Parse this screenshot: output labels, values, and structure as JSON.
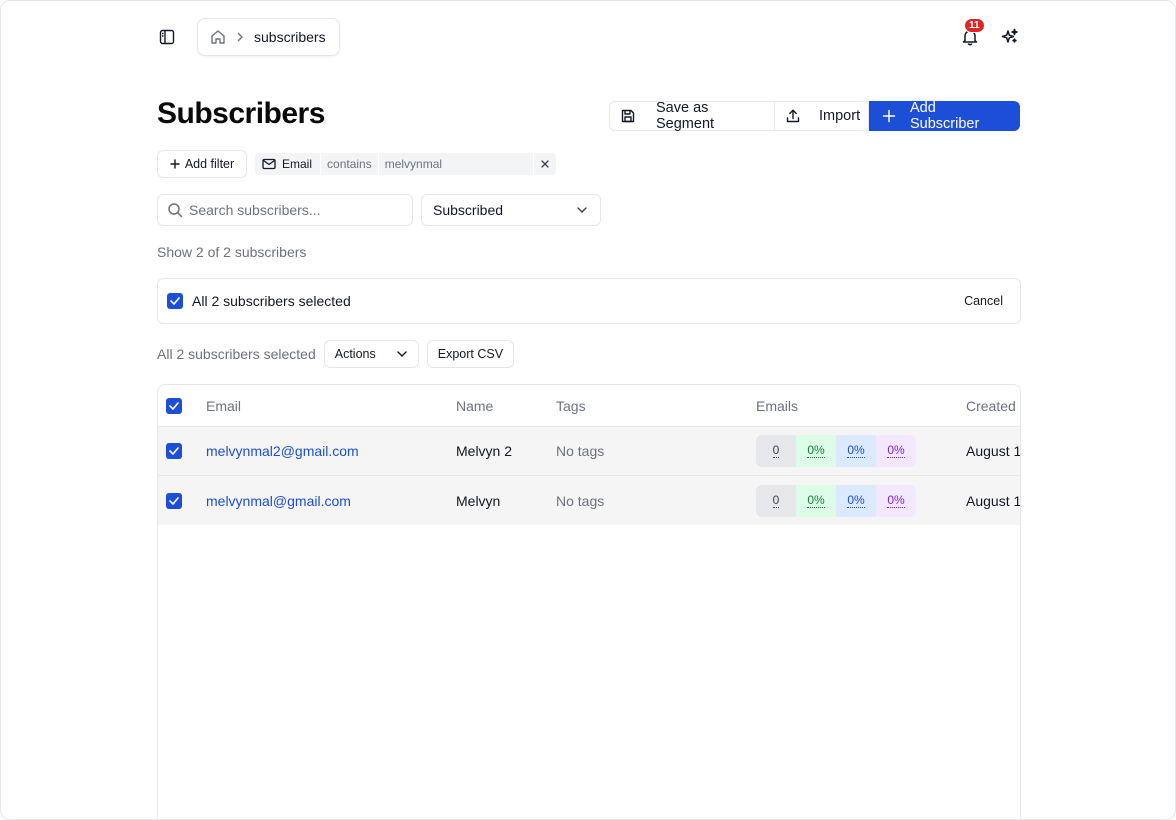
{
  "breadcrumb": {
    "current": "subscribers"
  },
  "notifications": {
    "count": "11"
  },
  "page": {
    "title": "Subscribers"
  },
  "header_actions": {
    "save_segment": "Save as Segment",
    "import": "Import",
    "add_subscriber": "Add Subscriber"
  },
  "filters": {
    "add_label": "Add filter",
    "active": {
      "field": "Email",
      "operator": "contains",
      "value": "melvynmal"
    }
  },
  "search": {
    "placeholder": "Search subscribers..."
  },
  "status_select": {
    "selected": "Subscribed"
  },
  "summary": {
    "count_text": "Show 2 of 2 subscribers"
  },
  "selection_bar": {
    "label": "All 2 subscribers selected",
    "cancel": "Cancel"
  },
  "bulk": {
    "text": "All 2 subscribers selected",
    "actions": "Actions",
    "export": "Export CSV"
  },
  "table": {
    "columns": {
      "email": "Email",
      "name": "Name",
      "tags": "Tags",
      "emails": "Emails",
      "created": "Created"
    },
    "rows": [
      {
        "email": "melvynmal2@gmail.com",
        "name": "Melvyn 2",
        "tags": "No tags",
        "stats": [
          "0",
          "0%",
          "0%",
          "0%"
        ],
        "created": "August 1"
      },
      {
        "email": "melvynmal@gmail.com",
        "name": "Melvyn",
        "tags": "No tags",
        "stats": [
          "0",
          "0%",
          "0%",
          "0%"
        ],
        "created": "August 1"
      }
    ]
  },
  "colors": {
    "primary": "#1d4ed8",
    "badge": "#dc2626"
  },
  "icons": [
    "sidebar-toggle-icon",
    "home-icon",
    "chevron-right-icon",
    "bell-icon",
    "sparkle-icon",
    "save-icon",
    "upload-icon",
    "plus-icon",
    "mail-icon",
    "close-icon",
    "search-icon",
    "chevron-down-icon",
    "check-icon"
  ]
}
